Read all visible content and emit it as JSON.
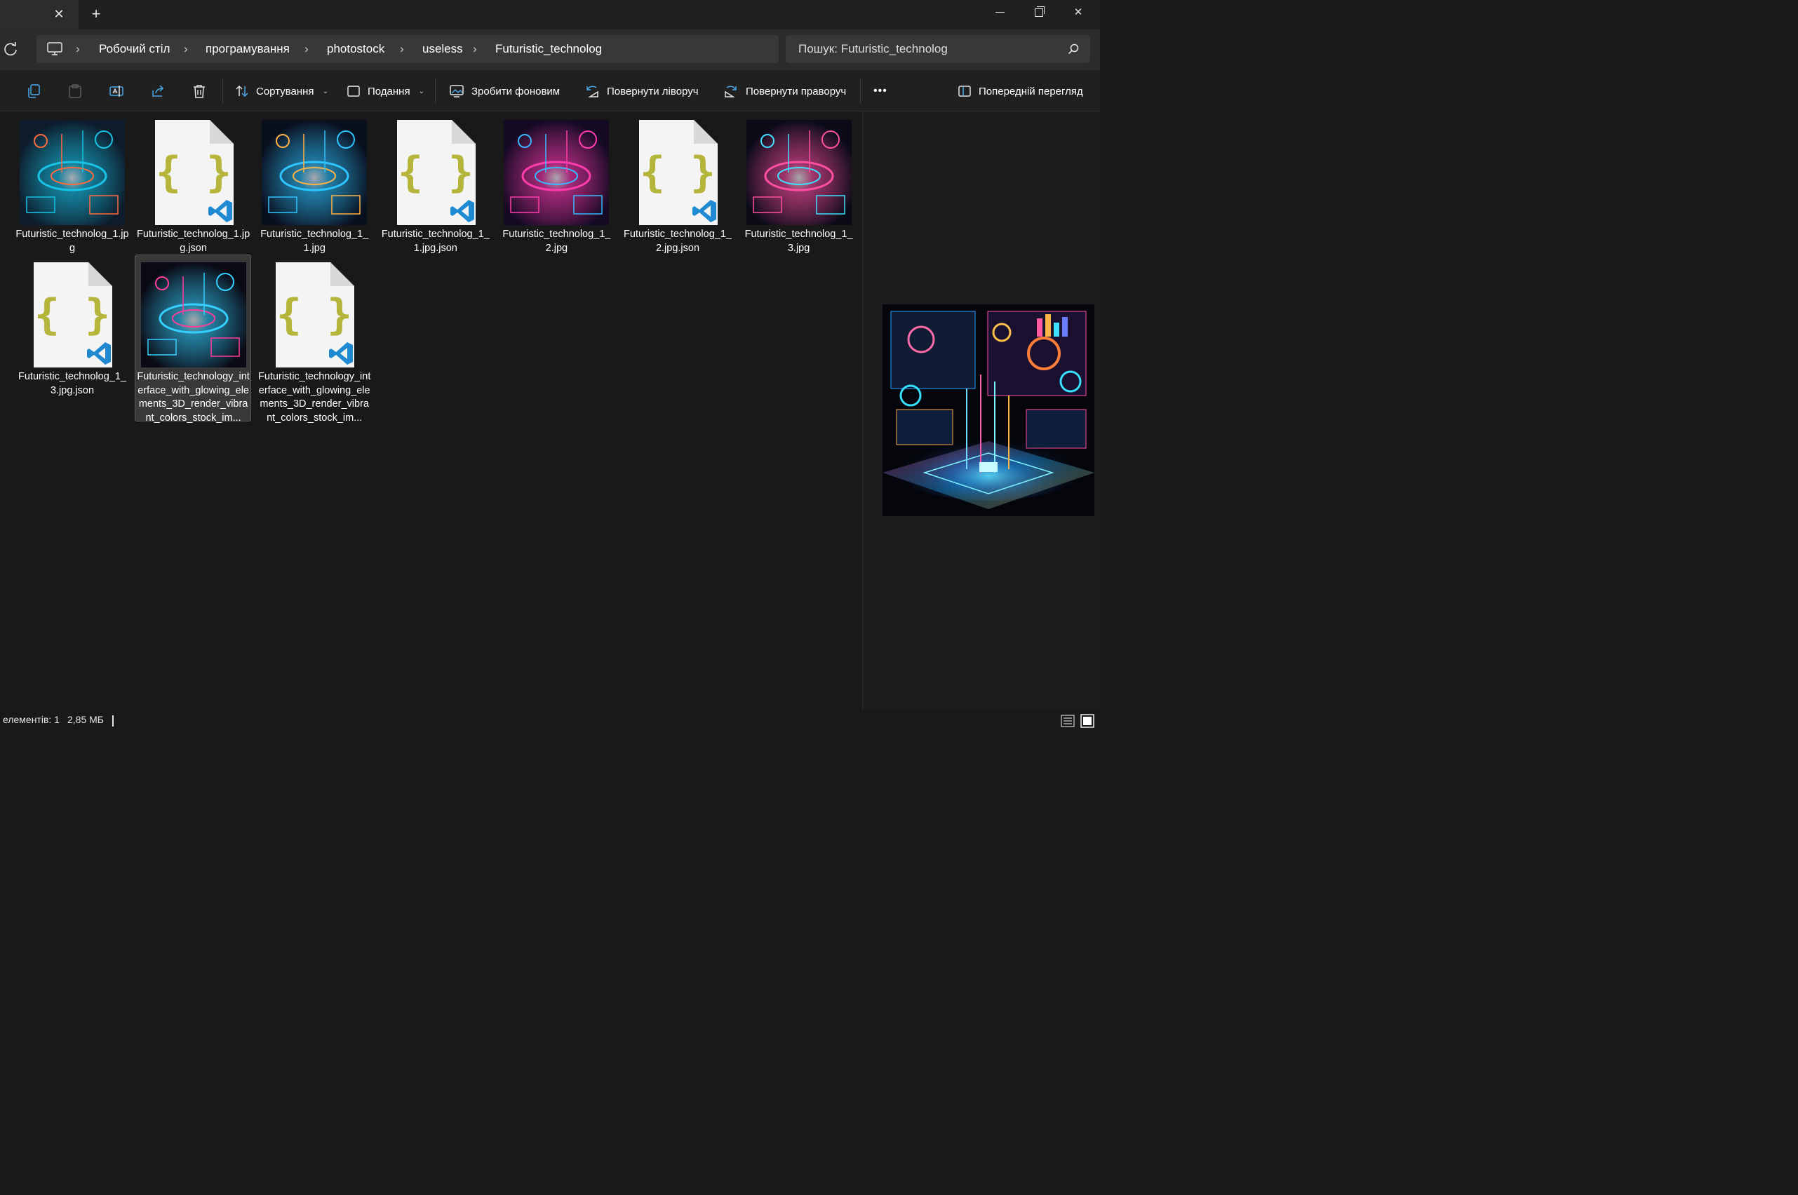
{
  "window": {
    "tab_close_glyph": "✕",
    "new_tab_glyph": "+",
    "close_glyph": "✕"
  },
  "address": {
    "breadcrumbs": [
      "Робочий стіл",
      "програмування",
      "photostock",
      "useless",
      "Futuristic_technolog"
    ],
    "separator": "›"
  },
  "search": {
    "placeholder": "Пошук: Futuristic_technolog"
  },
  "toolbar": {
    "sort_label": "Сортування",
    "view_label": "Подання",
    "set_background_label": "Зробити фоновим",
    "rotate_left_label": "Повернути ліворуч",
    "rotate_right_label": "Повернути праворуч",
    "more_label": "•••",
    "preview_label": "Попередній перегляд",
    "dropdown_glyph": "⌄"
  },
  "files": [
    {
      "name": "Futuristic_technolog_1.jpg",
      "type": "image",
      "palette": [
        "#0d1b2a",
        "#19c3e6",
        "#ff6a3d"
      ]
    },
    {
      "name": "Futuristic_technolog_1.jpg.json",
      "type": "json"
    },
    {
      "name": "Futuristic_technolog_1_1.jpg",
      "type": "image",
      "palette": [
        "#0a0f1e",
        "#2ec4ff",
        "#ffb347"
      ]
    },
    {
      "name": "Futuristic_technolog_1_1.jpg.json",
      "type": "json"
    },
    {
      "name": "Futuristic_technolog_1_2.jpg",
      "type": "image",
      "palette": [
        "#150a24",
        "#ff3cac",
        "#3ab8ff"
      ]
    },
    {
      "name": "Futuristic_technolog_1_2.jpg.json",
      "type": "json"
    },
    {
      "name": "Futuristic_technolog_1_3.jpg",
      "type": "image",
      "palette": [
        "#0b0b18",
        "#ff4fa0",
        "#3fe0ff"
      ]
    },
    {
      "name": "Futuristic_technolog_1_3.jpg.json",
      "type": "json"
    },
    {
      "name": "Futuristic_technology_interface_with_glowing_elements_3D_render_vibrant_colors_stock_im...",
      "type": "image",
      "selected": true,
      "palette": [
        "#0a0a14",
        "#35d0ff",
        "#ff3d9a"
      ]
    },
    {
      "name": "Futuristic_technology_interface_with_glowing_elements_3D_render_vibrant_colors_stock_im...",
      "type": "json"
    }
  ],
  "status": {
    "count": "елементів: 1",
    "size": "2,85 МБ"
  },
  "colors": {
    "json_brace": "#b5b53c",
    "vscode_blue": "#1f8ad2"
  }
}
